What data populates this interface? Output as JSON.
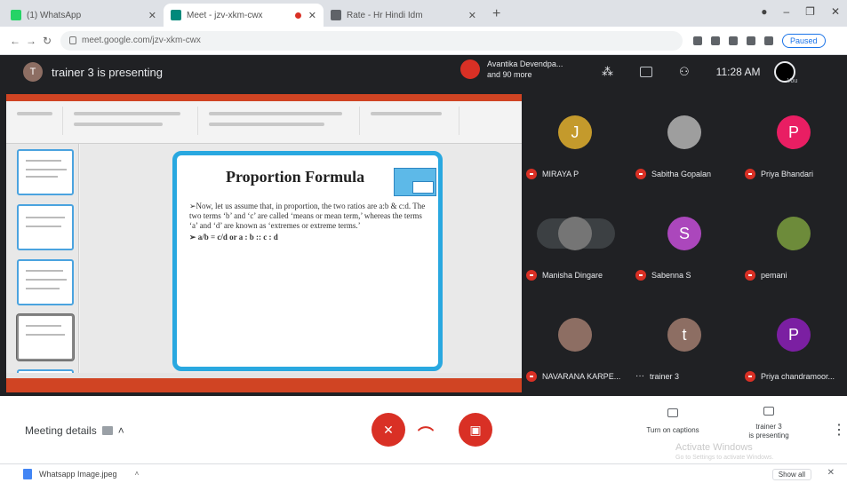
{
  "browser": {
    "tabs": [
      {
        "title": "(1) WhatsApp",
        "favicon_color": "#25d366",
        "active": false
      },
      {
        "title": "Meet - jzv-xkm-cwx",
        "favicon_color": "#00897b",
        "active": true,
        "recording": true
      },
      {
        "title": "Rate - Hr Hindi Idm",
        "favicon_color": "#5f6368",
        "active": false
      }
    ],
    "url": "meet.google.com/jzv-xkm-cwx",
    "paused_label": "Paused"
  },
  "meet": {
    "presenter_initial": "T",
    "presenting_text": "trainer 3 is presenting",
    "others_line1": "Avantika Devendpa...",
    "others_line2": "and 90 more",
    "time": "11:28 AM",
    "you_label": "You"
  },
  "slide": {
    "title": "Proportion Formula",
    "body": "➢Now, let us assume that, in proportion, the two ratios are a:b & c:d. The two terms ‘b’ and ‘c’ are called ‘means or mean term,’ whereas the terms ‘a’ and ‘d’ are known as ‘extremes or extreme terms.’",
    "formula": "➢ a/b = c/d or  a : b :: c : d"
  },
  "participants": [
    {
      "name": "MIRAYA P",
      "initial": "J",
      "color": "#c49a2c"
    },
    {
      "name": "Sabitha Gopalan",
      "initial": "",
      "color": "#9e9e9e"
    },
    {
      "name": "Priya Bhandari",
      "initial": "P",
      "color": "#e91e63"
    },
    {
      "name": "Manisha Dingare",
      "initial": "",
      "color": "#757575"
    },
    {
      "name": "Sabenna S",
      "initial": "S",
      "color": "#ab47bc"
    },
    {
      "name": "pemani",
      "initial": "",
      "color": "#6d8b3a"
    },
    {
      "name": "NAVARANA KARPE...",
      "initial": "",
      "color": "#8d6e63"
    },
    {
      "name": "trainer 3",
      "initial": "t",
      "color": "#8d6e63"
    },
    {
      "name": "Priya chandramoor...",
      "initial": "P",
      "color": "#7b1fa2"
    }
  ],
  "controls": {
    "meeting_details": "Meeting details",
    "captions": "Turn on captions",
    "presenting_line1": "trainer 3",
    "presenting_line2": "is presenting",
    "watermark1": "Activate Windows",
    "watermark2": "Go to Settings to activate Windows."
  },
  "downloads": {
    "file": "Whatsapp Image.jpeg",
    "show_all": "Show all"
  }
}
